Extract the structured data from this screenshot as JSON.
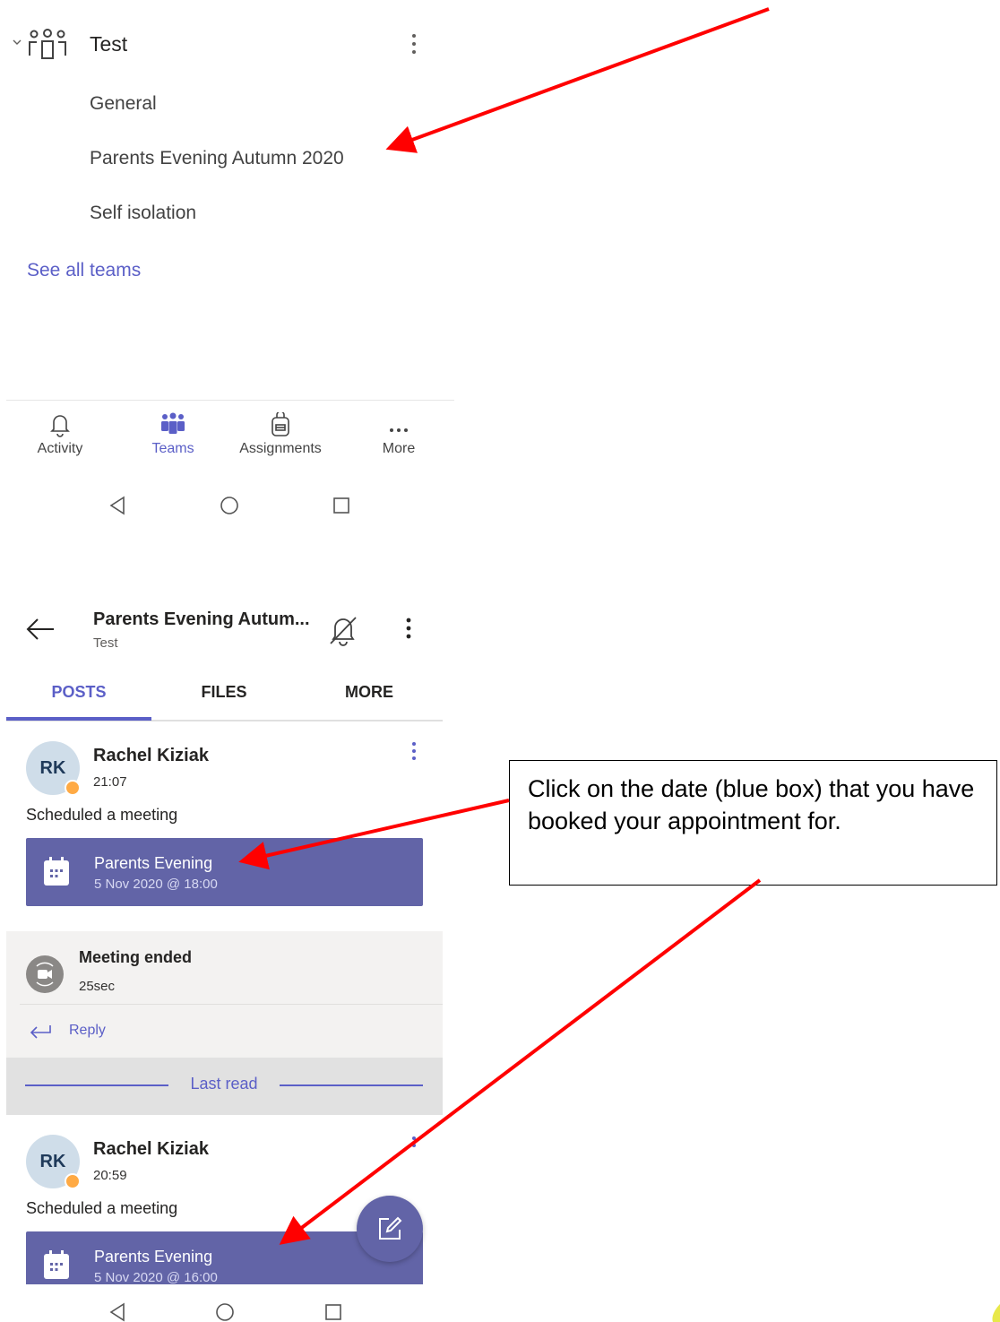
{
  "teams_list": {
    "team_name": "Test",
    "channels": [
      "General",
      "Parents Evening Autumn 2020",
      "Self isolation"
    ],
    "see_all": "See all teams"
  },
  "app_bar": {
    "items": [
      {
        "label": "Activity",
        "icon": "bell-icon",
        "active": false
      },
      {
        "label": "Teams",
        "icon": "teams-icon",
        "active": true
      },
      {
        "label": "Assignments",
        "icon": "backpack-icon",
        "active": false
      },
      {
        "label": "More",
        "icon": "more-horizontal-icon",
        "active": false
      }
    ]
  },
  "channel_view": {
    "title": "Parents Evening Autum...",
    "subtitle": "Test",
    "tabs": [
      "POSTS",
      "FILES",
      "MORE"
    ],
    "posts": [
      {
        "initials": "RK",
        "author": "Rachel Kiziak",
        "time": "21:07",
        "action": "Scheduled a meeting",
        "meeting_title": "Parents Evening",
        "meeting_date": "5 Nov 2020 @ 18:00"
      },
      {
        "initials": "RK",
        "author": "Rachel Kiziak",
        "time": "20:59",
        "action": "Scheduled a meeting",
        "meeting_title": "Parents Evening",
        "meeting_date": "5 Nov 2020 @ 16:00"
      }
    ],
    "meeting_ended": {
      "title": "Meeting ended",
      "duration": "25sec"
    },
    "reply": "Reply",
    "last_read": "Last read"
  },
  "annotation": {
    "callout": "Click on the date (blue box) that you have booked your appointment for.",
    "arrow_color": "#ff0000"
  },
  "colors": {
    "accent": "#6264a7",
    "link": "#5b5fc7"
  }
}
